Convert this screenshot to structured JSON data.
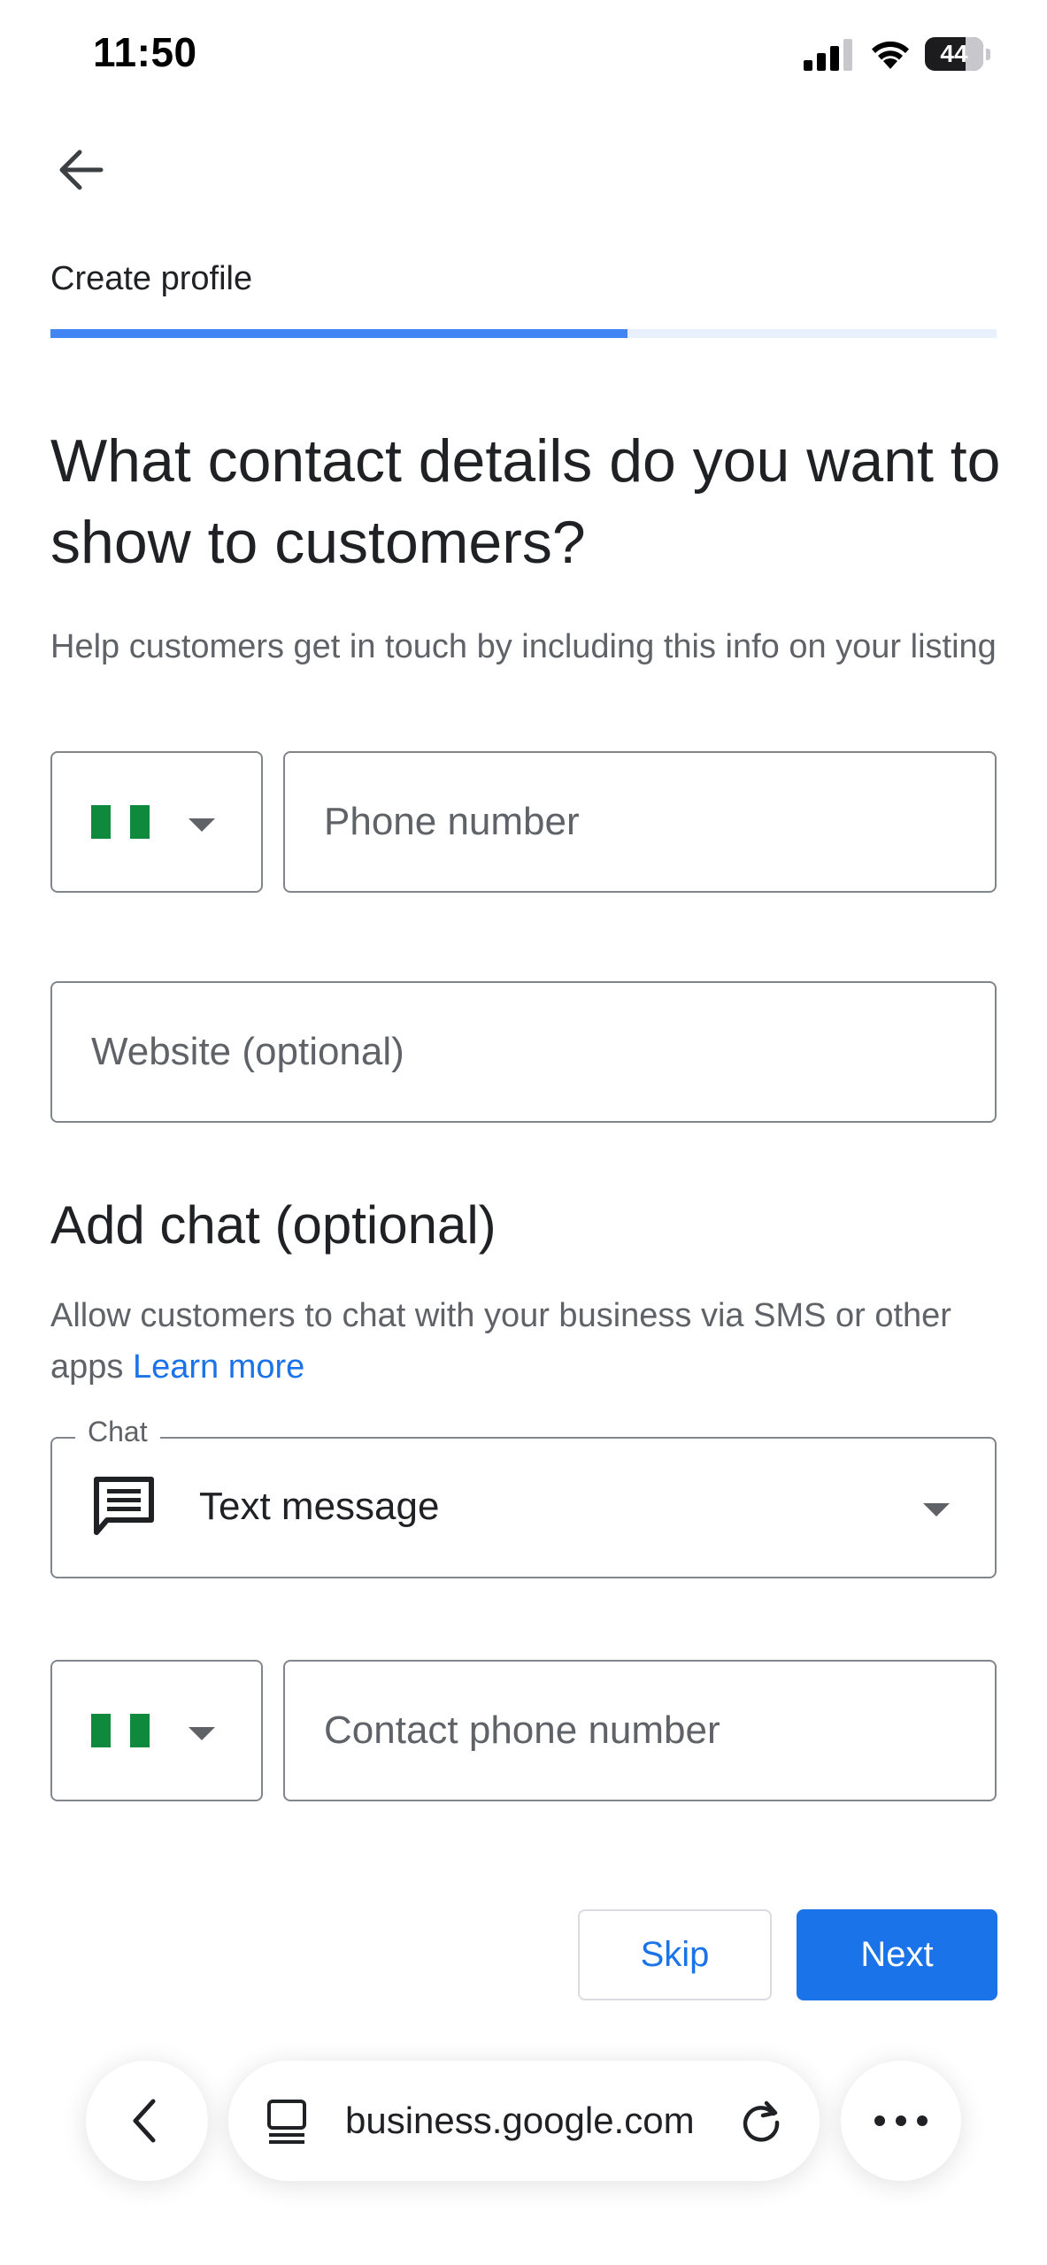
{
  "status_bar": {
    "time": "11:50",
    "battery": "44"
  },
  "header": {
    "step_title": "Create profile",
    "progress_percent": 61
  },
  "main": {
    "heading": "What contact details do you want to show to customers?",
    "description": "Help customers get in touch by including this info on your listing",
    "phone_country": "Nigeria",
    "phone_placeholder": "Phone number",
    "website_placeholder": "Website (optional)"
  },
  "chat": {
    "heading": "Add chat (optional)",
    "description": "Allow customers to chat with your business via SMS or other apps",
    "learn_more": "Learn more",
    "field_label": "Chat",
    "selected": "Text message",
    "contact_country": "Nigeria",
    "contact_placeholder": "Contact phone number"
  },
  "actions": {
    "skip_label": "Skip",
    "next_label": "Next"
  },
  "browser": {
    "url": "business.google.com"
  },
  "colors": {
    "accent": "#1a73e8",
    "progress": "#4285f4",
    "flag_green": "#0f8a3c"
  }
}
